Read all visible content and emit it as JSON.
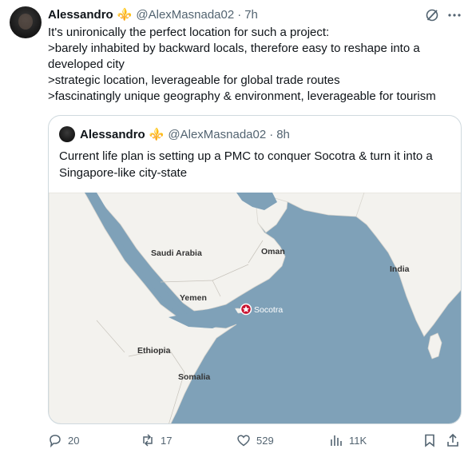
{
  "tweet": {
    "author_name": "Alessandro",
    "author_badge": "⚜️",
    "handle": "@AlexMasnada02",
    "separator": "·",
    "time": "7h",
    "lines": [
      "It's unironically the perfect location for such a project:",
      ">barely inhabited by backward locals, therefore easy to reshape into a",
      "developed city",
      ">strategic location, leverageable for global trade routes",
      ">fascinatingly unique geography & environment, leverageable for tourism"
    ]
  },
  "quote": {
    "author_name": "Alessandro",
    "handle": "@AlexMasnada02",
    "separator": "·",
    "time": "8h",
    "lines": [
      "Current life plan is setting up a PMC to conquer Socotra & turn it into a",
      "Singapore-like city-state"
    ],
    "map_labels": {
      "saudi": "Saudi Arabia",
      "oman": "Oman",
      "india": "India",
      "yemen": "Yemen",
      "socotra": "Socotra",
      "ethiopia": "Ethiopia",
      "somalia": "Somalia"
    }
  },
  "actions": {
    "replies": "20",
    "reposts": "17",
    "likes": "529",
    "views": "11K"
  },
  "icons": [
    "grok-icon",
    "more-icon",
    "reply-icon",
    "repost-icon",
    "like-icon",
    "views-icon",
    "bookmark-icon",
    "share-icon"
  ],
  "colors": {
    "text": "#0f1419",
    "secondary": "#536471",
    "badge": "#7856c4",
    "sea": "#7fa1b8",
    "land": "#f3f2ee",
    "marker": "#c8102e"
  }
}
